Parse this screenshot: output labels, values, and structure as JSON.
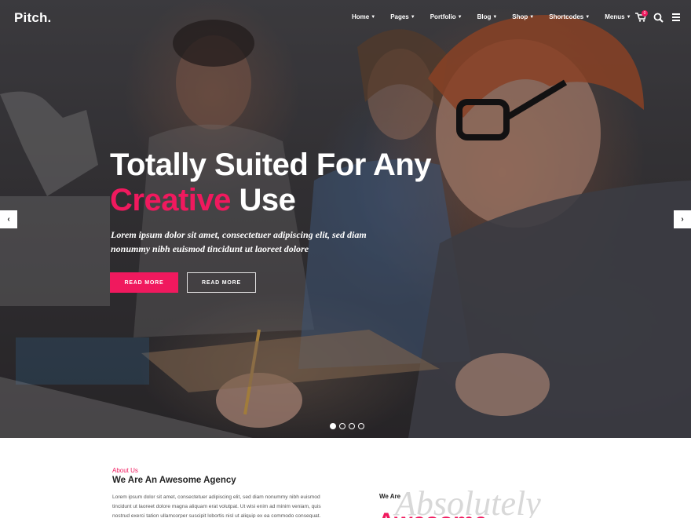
{
  "brand": {
    "logo": "Pitch.",
    "accent_color": "#f0195e"
  },
  "nav": {
    "items": [
      {
        "label": "Home"
      },
      {
        "label": "Pages"
      },
      {
        "label": "Portfolio"
      },
      {
        "label": "Blog"
      },
      {
        "label": "Shop"
      },
      {
        "label": "Shortcodes"
      },
      {
        "label": "Menus"
      }
    ],
    "cart_count": "0",
    "icons": [
      "cart-icon",
      "search-icon",
      "menu-grid-icon"
    ]
  },
  "hero": {
    "title_line1": "Totally Suited For Any",
    "title_accent": "Creative",
    "title_rest": " Use",
    "subtitle": "Lorem ipsum dolor sit amet, consectetuer adipiscing elit, sed diam nonummy nibh euismod tincidunt ut laoreet dolore",
    "button_primary": "READ MORE",
    "button_secondary": "READ MORE",
    "slide_count": 4,
    "active_slide": 1
  },
  "about": {
    "kicker": "About Us",
    "title": "We Are An Awesome Agency",
    "text": "Lorem ipsum dolor sit amet, consectetuer adipiscing elit, sed diam nonummy nibh euismod tincidunt ut laoreet dolore magna aliquam erat volutpat. Ut wisi enim ad minim veniam, quis nostrud exerci tation ullamcorper suscipit lobortis nisl ut aliquip ex ea commodo consequat.",
    "we_are": "We Are",
    "script_word": "Absolutely",
    "pink_word": "Awesome"
  }
}
